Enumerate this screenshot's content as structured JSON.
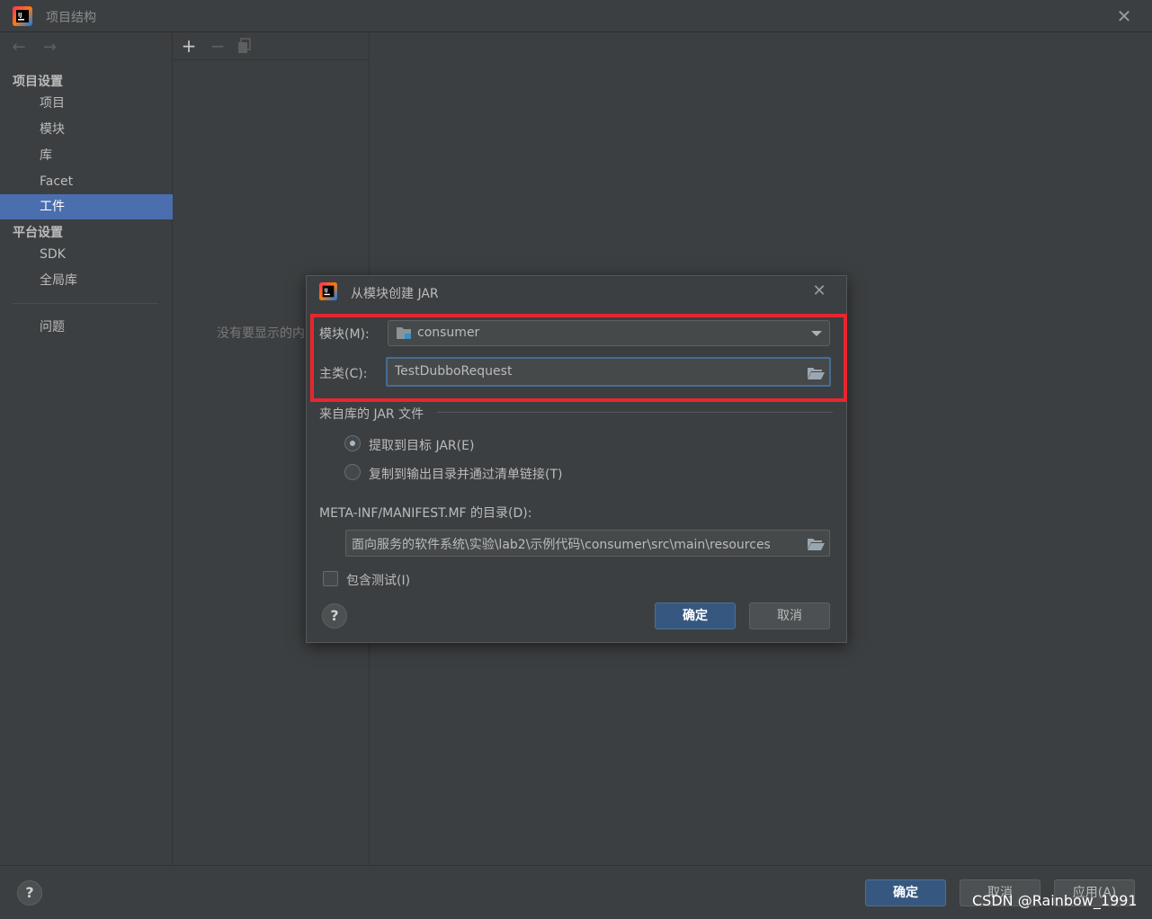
{
  "window": {
    "title": "项目结构"
  },
  "sidebar": {
    "section_project": "项目设置",
    "project_items": [
      {
        "label": "项目"
      },
      {
        "label": "模块"
      },
      {
        "label": "库"
      },
      {
        "label": "Facet"
      },
      {
        "label": "工件",
        "selected": true
      }
    ],
    "section_platform": "平台设置",
    "platform_items": [
      {
        "label": "SDK"
      },
      {
        "label": "全局库"
      }
    ],
    "problems_label": "问题"
  },
  "middle": {
    "empty_text": "没有要显示的内"
  },
  "dialog": {
    "title": "从模块创建 JAR",
    "module_label": "模块(M):",
    "module_value": "consumer",
    "main_class_label": "主类(C):",
    "main_class_value": "TestDubboRequest",
    "jar_group_label": "来自库的 JAR 文件",
    "radio_extract": {
      "label": "提取到目标 JAR(E)",
      "checked": true
    },
    "radio_copy": {
      "label": "复制到输出目录并通过清单链接(T)",
      "checked": false
    },
    "manifest_label": "META-INF/MANIFEST.MF 的目录(D):",
    "manifest_value": "面向服务的软件系统\\实验\\lab2\\示例代码\\consumer\\src\\main\\resources",
    "include_tests": {
      "label": "包含测试(I)",
      "checked": false
    },
    "ok_label": "确定",
    "cancel_label": "取消",
    "help_label": "?"
  },
  "footer": {
    "help_label": "?",
    "ok_label": "确定",
    "cancel_label": "取消",
    "apply_label": "应用(A)"
  },
  "watermark": "CSDN @Rainbow_1991",
  "colors": {
    "background": "#3c3f41",
    "selection": "#4b6eaf",
    "primary_button": "#365880",
    "highlight_border": "#e8262d"
  }
}
